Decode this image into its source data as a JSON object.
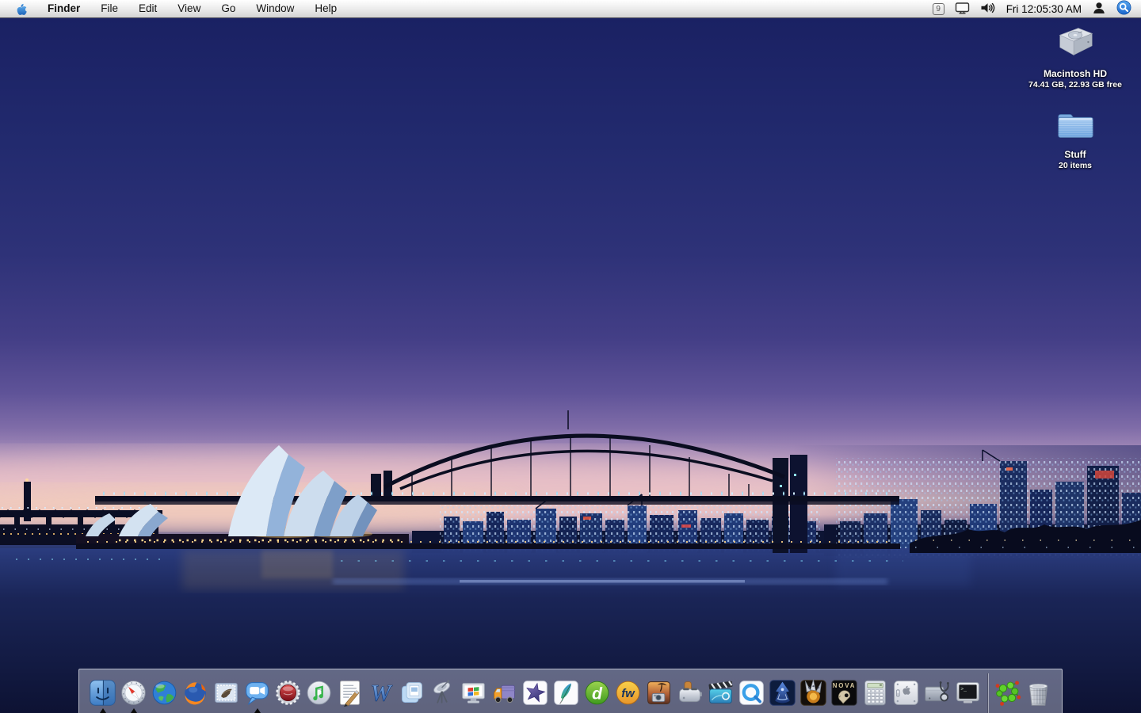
{
  "menu_bar": {
    "active_app": "Finder",
    "items": [
      "Finder",
      "File",
      "Edit",
      "View",
      "Go",
      "Window",
      "Help"
    ],
    "status": {
      "classic_badge": "9",
      "clock": "Fri 12:05:30 AM"
    },
    "status_icons": [
      "classic-environment-icon",
      "displays-icon",
      "volume-icon",
      "fast-user-switching-icon",
      "spotlight-icon"
    ]
  },
  "desktop_icons": [
    {
      "label": "Macintosh HD",
      "info": "74.41 GB, 22.93 GB free",
      "type": "hard-drive"
    },
    {
      "label": "Stuff",
      "info": "20 items",
      "type": "folder"
    }
  ],
  "dock": {
    "items": [
      {
        "name": "Finder",
        "running": true
      },
      {
        "name": "Safari",
        "running": true
      },
      {
        "name": "Globe web browser",
        "running": false
      },
      {
        "name": "Firefox",
        "running": false
      },
      {
        "name": "Mail",
        "running": false
      },
      {
        "name": "iChat",
        "running": true
      },
      {
        "name": "Bottle-cap media app",
        "running": false
      },
      {
        "name": "iTunes",
        "running": false
      },
      {
        "name": "TextEdit",
        "running": false
      },
      {
        "name": "Microsoft Word",
        "running": false
      },
      {
        "name": "Microsoft PowerPoint",
        "running": false
      },
      {
        "name": "Satellite-dish app",
        "running": false
      },
      {
        "name": "Virtual PC",
        "running": false
      },
      {
        "name": "Transmit",
        "running": false
      },
      {
        "name": "Adobe ImageReady",
        "running": false
      },
      {
        "name": "Adobe Photoshop",
        "running": false
      },
      {
        "name": "Dreamweaver",
        "running": false
      },
      {
        "name": "Fireworks",
        "running": false
      },
      {
        "name": "iPhoto",
        "running": false
      },
      {
        "name": "Toast",
        "running": false
      },
      {
        "name": "iMovie",
        "running": false
      },
      {
        "name": "QuickTime Player",
        "running": false
      },
      {
        "name": "Wizard game",
        "running": false
      },
      {
        "name": "Claw game",
        "running": false
      },
      {
        "name": "EV Nova",
        "running": false
      },
      {
        "name": "Calculator",
        "running": false
      },
      {
        "name": "System Preferences",
        "running": false
      },
      {
        "name": "Disk Utility",
        "running": false
      },
      {
        "name": "Terminal",
        "running": false
      },
      {
        "name": "Molecule document",
        "running": false
      },
      {
        "name": "Trash",
        "running": false
      }
    ]
  },
  "colors": {
    "sky_top": "#1a2163",
    "horizon_pink": "#e9c8c5",
    "water": "#17224f",
    "dock_bg": "rgba(221,223,238,0.40)"
  }
}
